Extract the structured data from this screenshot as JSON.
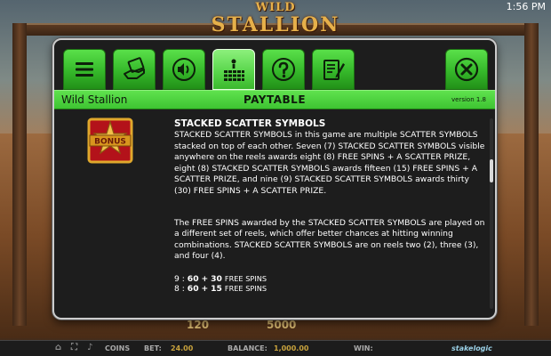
{
  "status_bar": {
    "time": "1:56 PM",
    "top_label": ""
  },
  "game_logo": {
    "line1": "WILD",
    "line2": "STALLION"
  },
  "dialog": {
    "tabs": [
      {
        "name": "menu",
        "icon": "hamburger-menu-icon"
      },
      {
        "name": "autoplay",
        "icon": "hand-card-icon"
      },
      {
        "name": "sound",
        "icon": "speaker-icon"
      },
      {
        "name": "paytable",
        "icon": "paytable-grid-icon",
        "active": true
      },
      {
        "name": "help",
        "icon": "question-mark-icon"
      },
      {
        "name": "history",
        "icon": "notepad-pencil-icon"
      },
      {
        "name": "close",
        "icon": "close-x-icon"
      }
    ],
    "game_name": "Wild Stallion",
    "section_title": "PAYTABLE",
    "version": "version 1.8",
    "symbol_label": "BONUS",
    "heading": "STACKED SCATTER SYMBOLS",
    "paragraph1": "STACKED SCATTER SYMBOLS in this game are multiple SCATTER SYMBOLS stacked on top of each other. Seven (7) STACKED SCATTER SYMBOLS visible anywhere on the reels awards eight (8) FREE SPINS + A SCATTER PRIZE, eight (8) STACKED SCATTER SYMBOLS awards fifteen (15) FREE SPINS + A SCATTER PRIZE, and nine (9) STACKED SCATTER SYMBOLS awards thirty (30) FREE SPINS + A SCATTER PRIZE.",
    "paragraph2": "The FREE SPINS awarded by the STACKED SCATTER SYMBOLS are played on a different set of reels, which offer better chances at hitting winning combinations. STACKED SCATTER SYMBOLS are on reels two (2), three (3), and four (4).",
    "pays": [
      {
        "count": "9",
        "multiplier": "60",
        "spins": "30",
        "label": "FREE SPINS"
      },
      {
        "count": "8",
        "multiplier": "60",
        "spins": "15",
        "label": "FREE SPINS"
      }
    ]
  },
  "game_bar": {
    "coins_label": "COINS",
    "bet_label": "BET:",
    "bet_value": "24.00",
    "balance_label": "BALANCE:",
    "balance_value": "1,000.00",
    "win_label": "WIN:",
    "brand": "stakelogic",
    "reel_num1": "120",
    "reel_num2": "5000"
  },
  "colors": {
    "tab_green": "#3ec432",
    "dialog_bg": "#1d1d1d",
    "text": "#ffffff"
  }
}
